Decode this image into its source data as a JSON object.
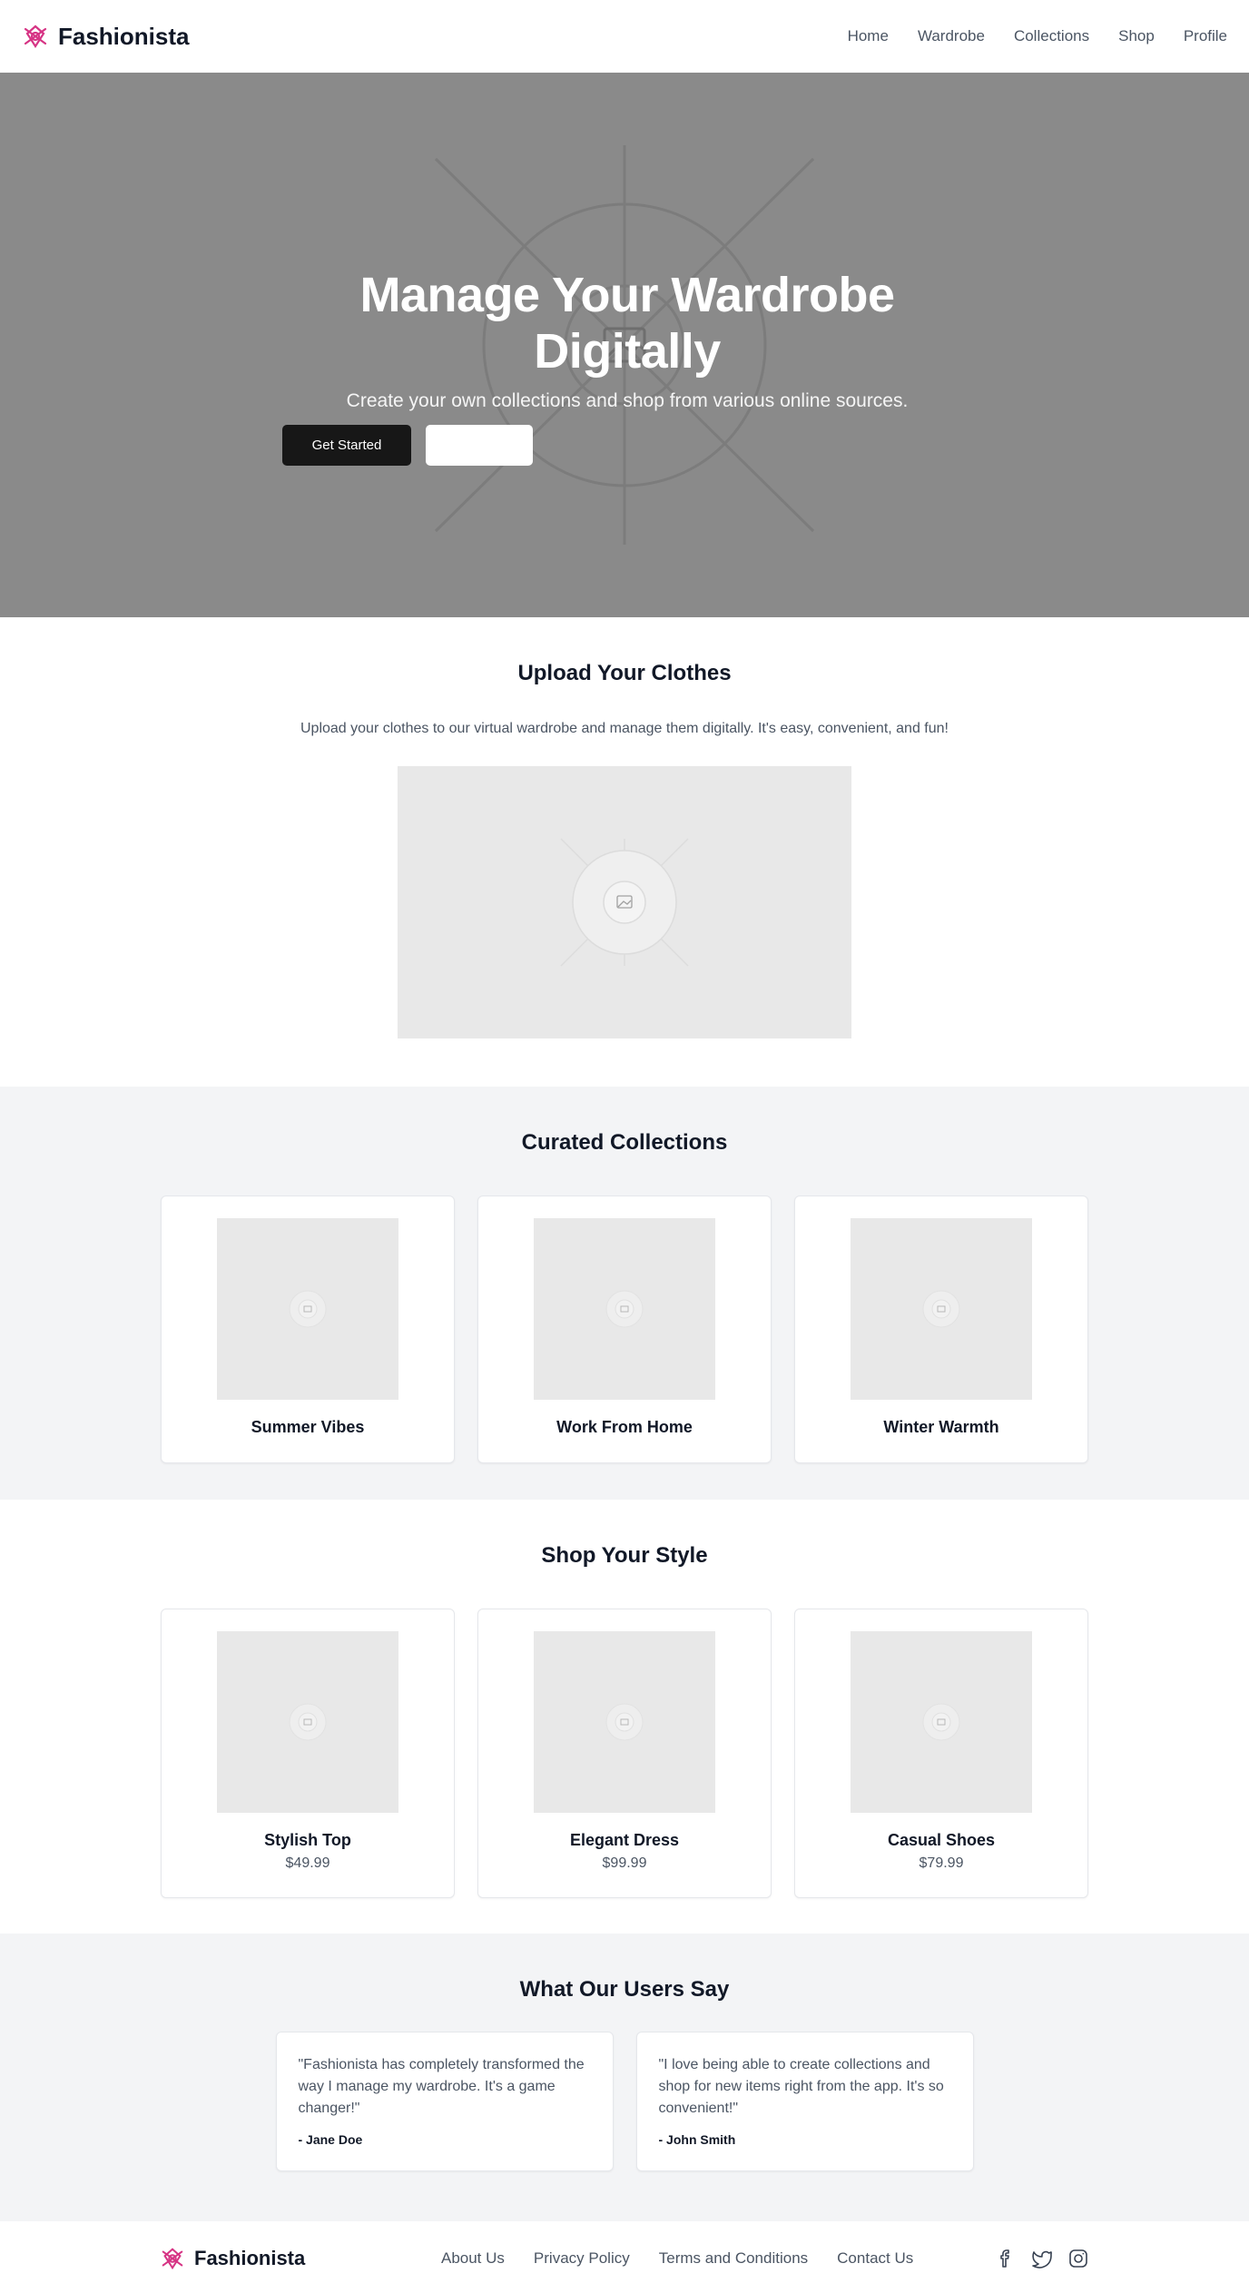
{
  "header": {
    "brand": "Fashionista",
    "logo_icon": "fashion-logo-icon",
    "nav": [
      {
        "label": "Home"
      },
      {
        "label": "Wardrobe"
      },
      {
        "label": "Collections"
      },
      {
        "label": "Shop"
      },
      {
        "label": "Profile"
      }
    ]
  },
  "hero": {
    "title": "Manage Your Wardrobe Digitally",
    "subtitle": "Create your own collections and shop from various online sources.",
    "primary_button": "Get Started",
    "secondary_button": "",
    "background_icon": "image-placeholder-icon"
  },
  "upload": {
    "title": "Upload Your Clothes",
    "description": "Upload your clothes to our virtual wardrobe and manage them digitally. It's easy, convenient, and fun!"
  },
  "collections": {
    "title": "Curated Collections",
    "items": [
      {
        "title": "Summer Vibes"
      },
      {
        "title": "Work From Home"
      },
      {
        "title": "Winter Warmth"
      }
    ]
  },
  "shop": {
    "title": "Shop Your Style",
    "items": [
      {
        "title": "Stylish Top",
        "price": "$49.99"
      },
      {
        "title": "Elegant Dress",
        "price": "$99.99"
      },
      {
        "title": "Casual Shoes",
        "price": "$79.99"
      }
    ]
  },
  "testimonials": {
    "title": "What Our Users Say",
    "items": [
      {
        "quote": "\"Fashionista has completely transformed the way I manage my wardrobe. It's a game changer!\"",
        "author": "- Jane Doe"
      },
      {
        "quote": "\"I love being able to create collections and shop for new items right from the app. It's so convenient!\"",
        "author": "- John Smith"
      }
    ]
  },
  "footer": {
    "brand": "Fashionista",
    "links": [
      {
        "label": "About Us"
      },
      {
        "label": "Privacy Policy"
      },
      {
        "label": "Terms and Conditions"
      },
      {
        "label": "Contact Us"
      }
    ],
    "socials": [
      "facebook-icon",
      "twitter-icon",
      "instagram-icon"
    ]
  },
  "colors": {
    "brand_accent": "#d63384",
    "primary_button": "#171717",
    "hero_bg": "#8a8a8a",
    "section_gray": "#f3f4f6"
  }
}
